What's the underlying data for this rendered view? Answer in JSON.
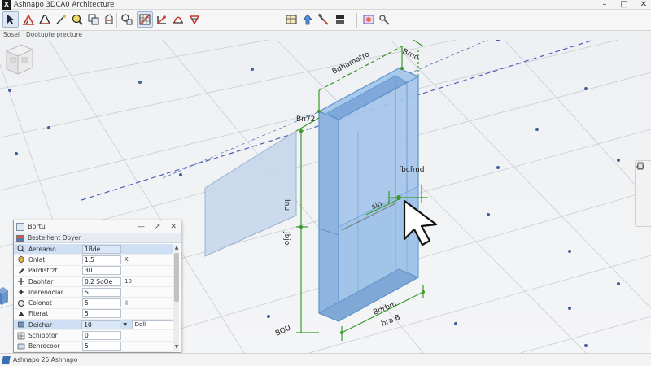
{
  "window": {
    "title": "Ashnapo 3DCA0 Architecture",
    "logo_text": "X",
    "controls": [
      "–",
      "□",
      "✕"
    ]
  },
  "subbar": {
    "items": [
      "Sosei",
      "Dootupte precture"
    ]
  },
  "toolbar": {
    "left_tools": [
      "select-arrow-icon",
      "sketch-icon",
      "wall-icon",
      "line-icon",
      "zoom-icon",
      "copy-icon",
      "shapes-icon",
      "grid-icon",
      "axis-icon",
      "sun-icon"
    ],
    "right_tools": [
      "layers-icon",
      "up-icon",
      "hammer-icon",
      "stack-icon",
      "render-icon",
      "link-icon"
    ]
  },
  "viewport": {
    "labels": {
      "top_width": "Bdhamotro",
      "top_right": "Brno",
      "left_top": "Bn72",
      "right_mid": "fbcfmd",
      "cursor_label": "sin",
      "height_upper": "Inu",
      "height_lower": "Jbjol",
      "bottom_left": "BOU",
      "bottom_right_1": "Bdrbm",
      "bottom_right_2": "bra B"
    },
    "accent": "#3f8fd6",
    "dim_color": "#3a9a2a"
  },
  "panel": {
    "title": "Bortu",
    "ctrl_min": "—",
    "ctrl_pop": "↗",
    "ctrl_close": "✕",
    "subheader": "Bestelhent Doyer",
    "rows": [
      {
        "icon": "search-icon",
        "label": "Aeteamo",
        "value": "1Bde",
        "unit": "",
        "selected": true
      },
      {
        "icon": "cube-icon",
        "label": "Onlat",
        "value": "1.5",
        "unit": "K",
        "selected": false
      },
      {
        "icon": "pen-icon",
        "label": "Pardistrzt",
        "value": "30",
        "unit": "",
        "selected": false
      },
      {
        "icon": "plus-icon",
        "label": "Daohtar",
        "value": "0.2 SoOe",
        "unit": "10",
        "selected": false
      },
      {
        "icon": "spark-icon",
        "label": "Iderenoolar",
        "value": "S",
        "unit": "",
        "selected": false
      },
      {
        "icon": "circle-icon",
        "label": "Colonot",
        "value": "5",
        "unit": "ll",
        "selected": false
      },
      {
        "icon": "triangle-icon",
        "label": "Fiterat",
        "value": "5",
        "unit": "",
        "selected": false
      },
      {
        "icon": "box-icon",
        "label": "Deichar",
        "value": "10",
        "unit": "",
        "dropdown": "Doll",
        "selected": true
      },
      {
        "icon": "grid-icon",
        "label": "Schibotor",
        "value": "0",
        "unit": "",
        "selected": false
      },
      {
        "icon": "frame-icon",
        "label": "Benrecoor",
        "value": "5",
        "unit": "",
        "selected": false
      }
    ]
  },
  "status": {
    "text": "Ashnapo 25 Ashnapo"
  }
}
